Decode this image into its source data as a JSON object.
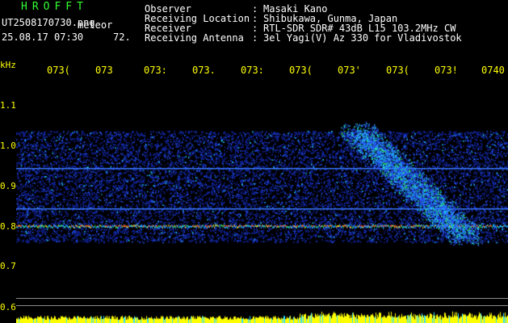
{
  "header": {
    "logo": "HROFFT",
    "filename": "UT2508170730.png",
    "meteor_label": "meteor",
    "datetime": "25.08.17 07:30",
    "count": "72."
  },
  "info": [
    {
      "label": "Observer",
      "value": "Masaki Kano"
    },
    {
      "label": "Receiving Location",
      "value": "Shibukawa, Gunma, Japan"
    },
    {
      "label": "Receiver",
      "value": "RTL-SDR SDR# 43dB L15 103.2MHz CW"
    },
    {
      "label": "Receiving Antenna",
      "value": "3el Yagi(V) Az 330 for Vladivostok"
    }
  ],
  "info_colon": ":",
  "axis": {
    "unit": "kHz",
    "time_ticks": [
      "073(",
      "073",
      "073:",
      "073.",
      "073:",
      "073(",
      "073'",
      "073(",
      "073!",
      "0740"
    ],
    "freq_ticks": [
      "1.1",
      "1.0",
      "0.9",
      "0.8",
      "0.7",
      "0.6"
    ]
  },
  "colors": {
    "header_green": "#33ff33",
    "axis_yellow": "#ffff00",
    "signal_blue": "#1e3cff",
    "amp_yellow": "#ffff00"
  }
}
